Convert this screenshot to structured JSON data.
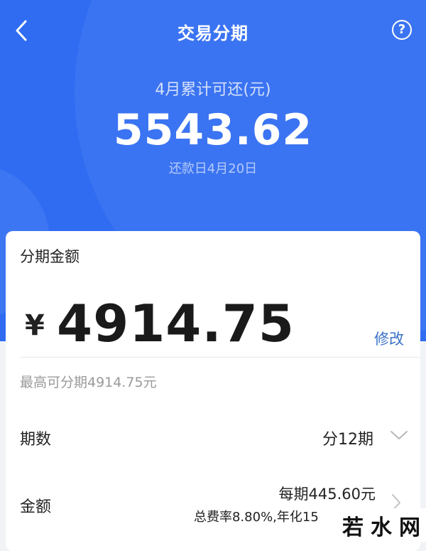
{
  "header": {
    "title": "交易分期",
    "back_icon": "back-arrow-icon",
    "help_icon": "question-circle-icon",
    "help_glyph": "?"
  },
  "summary": {
    "label": "4月累计可还(元)",
    "amount": "5543.62",
    "due_date": "还款日4月20日"
  },
  "installment": {
    "label": "分期金额",
    "currency": "¥",
    "amount": "4914.75",
    "modify_label": "修改",
    "limit_text": "最高可分期4914.75元"
  },
  "periods": {
    "label": "期数",
    "value": "分12期",
    "icon": "chevron-down-icon"
  },
  "amount_row": {
    "label": "金额",
    "monthly": "每期445.60元",
    "fee": "总费率8.80%,年化15",
    "icon": "chevron-right-icon"
  },
  "watermark": {
    "text": "若水网"
  },
  "colors": {
    "primary": "#2f6cf2",
    "link": "#3a72c8"
  }
}
